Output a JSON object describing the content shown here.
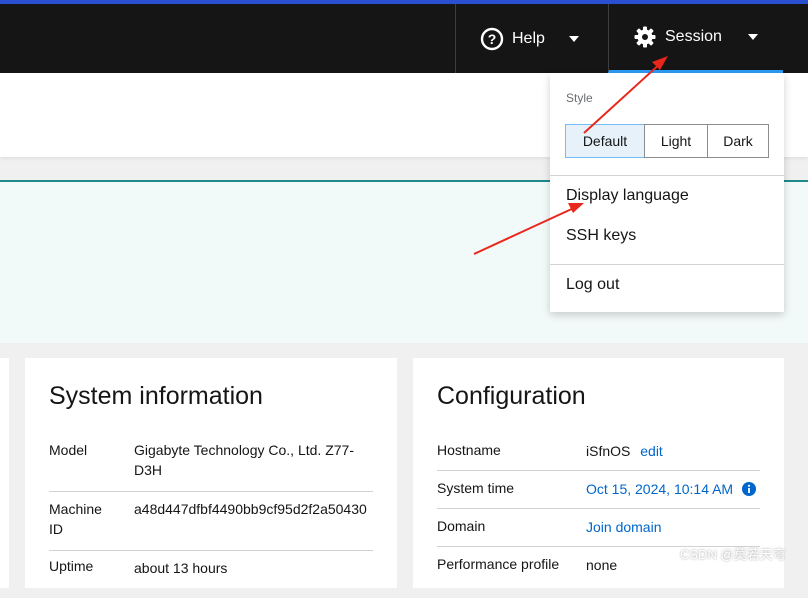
{
  "topbar": {
    "help_label": "Help",
    "session_label": "Session"
  },
  "session_menu": {
    "style_label": "Style",
    "style_options": [
      "Default",
      "Light",
      "Dark"
    ],
    "selected_style": "Default",
    "display_language": "Display language",
    "ssh_keys": "SSH keys",
    "log_out": "Log out"
  },
  "system_information": {
    "title": "System information",
    "rows": [
      {
        "key": "Model",
        "value": "Gigabyte Technology Co., Ltd. Z77-D3H"
      },
      {
        "key": "Machine ID",
        "value": "a48d447dfbf4490bb9cf95d2f2a50430"
      },
      {
        "key": "Uptime",
        "value": "about 13 hours"
      }
    ]
  },
  "configuration": {
    "title": "Configuration",
    "rows": [
      {
        "key": "Hostname",
        "value": "iSfnOS",
        "link": "edit"
      },
      {
        "key": "System time",
        "value": "Oct 15, 2024, 10:14 AM"
      },
      {
        "key": "Domain",
        "value": "Join domain"
      },
      {
        "key": "Performance profile",
        "value": "none"
      }
    ]
  },
  "watermark": "CSDN @莫若天穹",
  "colors": {
    "accent": "#2b9af3",
    "link": "#0066cc",
    "arrow": "#e8261b"
  }
}
